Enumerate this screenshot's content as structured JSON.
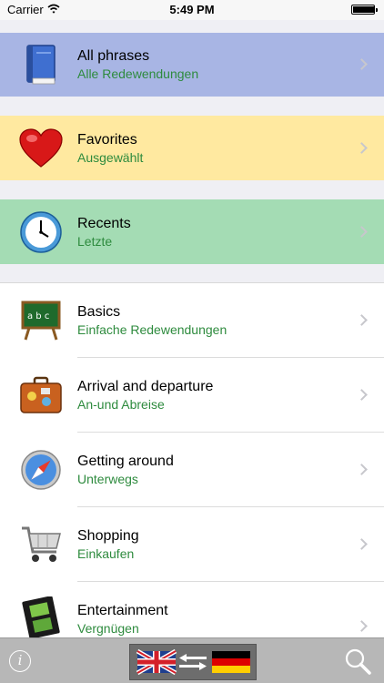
{
  "status_bar": {
    "carrier": "Carrier",
    "time": "5:49 PM"
  },
  "highlight_rows": [
    {
      "title": "All phrases",
      "subtitle": "Alle Redewendungen",
      "icon": "book-icon",
      "color": "#a8b5e4"
    },
    {
      "title": "Favorites",
      "subtitle": "Ausgewählt",
      "icon": "heart-icon",
      "color": "#ffe9a0"
    },
    {
      "title": "Recents",
      "subtitle": "Letzte",
      "icon": "clock-icon",
      "color": "#a4dcb4"
    }
  ],
  "categories": [
    {
      "title": "Basics",
      "subtitle": "Einfache Redewendungen",
      "icon": "chalkboard-icon"
    },
    {
      "title": "Arrival and departure",
      "subtitle": "An-und Abreise",
      "icon": "suitcase-icon"
    },
    {
      "title": "Getting around",
      "subtitle": "Unterwegs",
      "icon": "compass-icon"
    },
    {
      "title": "Shopping",
      "subtitle": "Einkaufen",
      "icon": "shopping-cart-icon"
    },
    {
      "title": "Entertainment",
      "subtitle": "Vergnügen",
      "icon": "film-strip-icon"
    }
  ],
  "toolbar": {
    "info_icon": "info-icon",
    "language_switch": "uk-de-flag-switch-icon",
    "search_icon": "search-icon"
  },
  "colors": {
    "subtitle_green": "#2e8b3e",
    "background": "#efeff4",
    "toolbar": "#b7b7b7"
  }
}
